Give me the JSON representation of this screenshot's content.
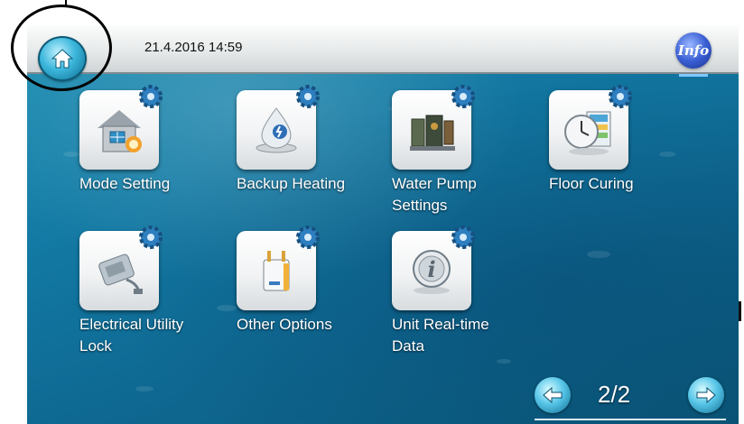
{
  "header": {
    "datetime": "21.4.2016 14:59",
    "info_label": "Info"
  },
  "menu": {
    "items": [
      {
        "label": "Mode Setting",
        "icon": "house-icon"
      },
      {
        "label": "Backup Heating",
        "icon": "water-drop-icon"
      },
      {
        "label": "Water Pump Settings",
        "line1": "Water Pump",
        "line2": "Settings",
        "icon": "pump-icon"
      },
      {
        "label": "Floor Curing",
        "icon": "clock-icon"
      },
      {
        "label": "Electrical Utility Lock",
        "line1": "Electrical Utility",
        "line2": "Lock",
        "icon": "plug-icon"
      },
      {
        "label": "Other Options",
        "icon": "boiler-icon"
      },
      {
        "label": "Unit Real-time Data",
        "line1": "Unit Real-time",
        "line2": "Data",
        "icon": "info-icon"
      }
    ]
  },
  "pager": {
    "indicator": "2/2"
  },
  "colors": {
    "screen_bg": "#1279a3",
    "topbar_bg": "#e7eaea",
    "accent_home": "#3db7dc",
    "accent_info": "#3a5fd4"
  }
}
